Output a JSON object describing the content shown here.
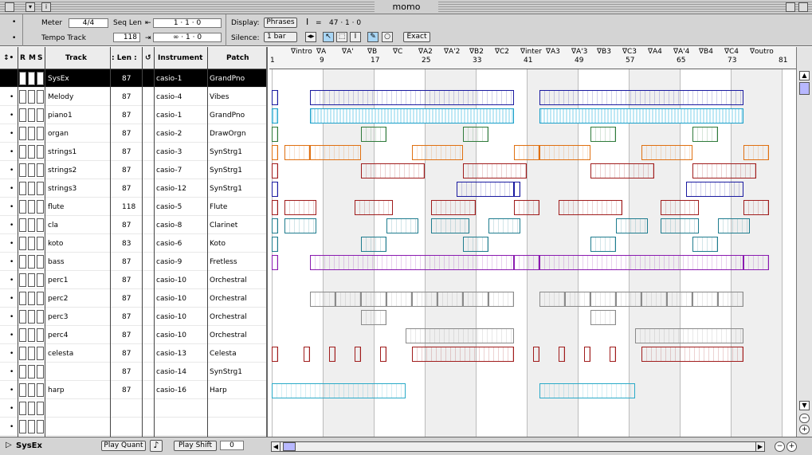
{
  "window": {
    "title": "momo"
  },
  "toolbar": {
    "meter_label": "Meter",
    "meter_value": "4/4",
    "seqlen_label": "Seq Len",
    "seqlen_value": "118",
    "tempo_label": "Tempo Track",
    "position_start": "1 · 1 · 0",
    "position_end": "∞ · 1 · 0",
    "display_label": "Display:",
    "display_value": "Phrases",
    "silence_label": "Silence:",
    "silence_value": "1 bar",
    "cursor_pos": "47 · 1 · 0",
    "exact_label": "Exact"
  },
  "tracklist": {
    "headers": {
      "r": "R",
      "m": "M",
      "s": "S",
      "track": "Track",
      "len": ": Len :",
      "instrument": "Instrument",
      "patch": "Patch"
    },
    "rows": [
      {
        "name": "SysEx",
        "len": "87",
        "instrument": "casio-1",
        "patch": "GrandPno"
      },
      {
        "name": "Melody",
        "len": "87",
        "instrument": "casio-4",
        "patch": "Vibes"
      },
      {
        "name": "piano1",
        "len": "87",
        "instrument": "casio-1",
        "patch": "GrandPno"
      },
      {
        "name": "organ",
        "len": "87",
        "instrument": "casio-2",
        "patch": "DrawOrgn"
      },
      {
        "name": "strings1",
        "len": "87",
        "instrument": "casio-3",
        "patch": "SynStrg1"
      },
      {
        "name": "strings2",
        "len": "87",
        "instrument": "casio-7",
        "patch": "SynStrg1"
      },
      {
        "name": "strings3",
        "len": "87",
        "instrument": "casio-12",
        "patch": "SynStrg1"
      },
      {
        "name": "flute",
        "len": "118",
        "instrument": "casio-5",
        "patch": "Flute"
      },
      {
        "name": "cla",
        "len": "87",
        "instrument": "casio-8",
        "patch": "Clarinet"
      },
      {
        "name": "koto",
        "len": "83",
        "instrument": "casio-6",
        "patch": "Koto"
      },
      {
        "name": "bass",
        "len": "87",
        "instrument": "casio-9",
        "patch": "Fretless"
      },
      {
        "name": "perc1",
        "len": "87",
        "instrument": "casio-10",
        "patch": "Orchestral"
      },
      {
        "name": "perc2",
        "len": "87",
        "instrument": "casio-10",
        "patch": "Orchestral"
      },
      {
        "name": "perc3",
        "len": "87",
        "instrument": "casio-10",
        "patch": "Orchestral"
      },
      {
        "name": "perc4",
        "len": "87",
        "instrument": "casio-10",
        "patch": "Orchestral"
      },
      {
        "name": "celesta",
        "len": "87",
        "instrument": "casio-13",
        "patch": "Celesta"
      },
      {
        "name": "",
        "len": "87",
        "instrument": "casio-14",
        "patch": "SynStrg1"
      },
      {
        "name": "harp",
        "len": "87",
        "instrument": "casio-16",
        "patch": "Harp"
      },
      {
        "name": "",
        "len": "",
        "instrument": "",
        "patch": ""
      },
      {
        "name": "",
        "len": "",
        "instrument": "",
        "patch": ""
      }
    ]
  },
  "ruler": {
    "markers": [
      {
        "label": "∇intro",
        "bar": 3
      },
      {
        "label": "∇A",
        "bar": 7
      },
      {
        "label": "∇A'",
        "bar": 11
      },
      {
        "label": "∇B",
        "bar": 15
      },
      {
        "label": "∇C",
        "bar": 19
      },
      {
        "label": "∇A2",
        "bar": 23
      },
      {
        "label": "∇A'2",
        "bar": 27
      },
      {
        "label": "∇B2",
        "bar": 31
      },
      {
        "label": "∇C2",
        "bar": 35
      },
      {
        "label": "∇inter",
        "bar": 39
      },
      {
        "label": "∇A3",
        "bar": 43
      },
      {
        "label": "∇A'3",
        "bar": 47
      },
      {
        "label": "∇B3",
        "bar": 51
      },
      {
        "label": "∇C3",
        "bar": 55
      },
      {
        "label": "∇A4",
        "bar": 59
      },
      {
        "label": "∇A'4",
        "bar": 63
      },
      {
        "label": "∇B4",
        "bar": 67
      },
      {
        "label": "∇C4",
        "bar": 71
      },
      {
        "label": "∇outro",
        "bar": 75
      }
    ],
    "bars": [
      "1",
      "9",
      "17",
      "25",
      "33",
      "41",
      "49",
      "57",
      "65",
      "73",
      "81"
    ]
  },
  "colors": {
    "blue": "#1a1aa0",
    "cyan": "#1a9fc8",
    "green": "#2e7a3a",
    "orange": "#e07010",
    "red": "#a01c1c",
    "teal": "#1e7c8e",
    "purple": "#8a1ab0",
    "gray": "#8a8a8a",
    "harp": "#2aaac8"
  },
  "phrases": [
    {
      "row": 1,
      "color": "blue",
      "from": 1,
      "to": 2
    },
    {
      "row": 1,
      "color": "blue",
      "from": 7,
      "to": 39
    },
    {
      "row": 1,
      "color": "blue",
      "from": 43,
      "to": 75
    },
    {
      "row": 2,
      "color": "cyan",
      "from": 1,
      "to": 2
    },
    {
      "row": 2,
      "color": "cyan",
      "from": 7,
      "to": 39
    },
    {
      "row": 2,
      "color": "cyan",
      "from": 43,
      "to": 75
    },
    {
      "row": 3,
      "color": "green",
      "from": 1,
      "to": 2
    },
    {
      "row": 3,
      "color": "green",
      "from": 15,
      "to": 19
    },
    {
      "row": 3,
      "color": "green",
      "from": 31,
      "to": 35
    },
    {
      "row": 3,
      "color": "green",
      "from": 51,
      "to": 55
    },
    {
      "row": 3,
      "color": "green",
      "from": 67,
      "to": 71
    },
    {
      "row": 4,
      "color": "orange",
      "from": 1,
      "to": 2
    },
    {
      "row": 4,
      "color": "orange",
      "from": 3,
      "to": 7
    },
    {
      "row": 4,
      "color": "orange",
      "from": 7,
      "to": 15
    },
    {
      "row": 4,
      "color": "orange",
      "from": 23,
      "to": 31
    },
    {
      "row": 4,
      "color": "orange",
      "from": 39,
      "to": 43
    },
    {
      "row": 4,
      "color": "orange",
      "from": 43,
      "to": 51
    },
    {
      "row": 4,
      "color": "orange",
      "from": 59,
      "to": 67
    },
    {
      "row": 4,
      "color": "orange",
      "from": 75,
      "to": 79
    },
    {
      "row": 5,
      "color": "red",
      "from": 1,
      "to": 2
    },
    {
      "row": 5,
      "color": "red",
      "from": 15,
      "to": 25
    },
    {
      "row": 5,
      "color": "red",
      "from": 31,
      "to": 41
    },
    {
      "row": 5,
      "color": "red",
      "from": 51,
      "to": 61
    },
    {
      "row": 5,
      "color": "red",
      "from": 67,
      "to": 77
    },
    {
      "row": 6,
      "color": "blue",
      "from": 1,
      "to": 2
    },
    {
      "row": 6,
      "color": "blue",
      "from": 30,
      "to": 39
    },
    {
      "row": 6,
      "color": "blue",
      "from": 39,
      "to": 40
    },
    {
      "row": 6,
      "color": "blue",
      "from": 66,
      "to": 75
    },
    {
      "row": 7,
      "color": "red",
      "from": 1,
      "to": 2
    },
    {
      "row": 7,
      "color": "red",
      "from": 3,
      "to": 8
    },
    {
      "row": 7,
      "color": "red",
      "from": 14,
      "to": 20
    },
    {
      "row": 7,
      "color": "red",
      "from": 26,
      "to": 33
    },
    {
      "row": 7,
      "color": "red",
      "from": 39,
      "to": 43
    },
    {
      "row": 7,
      "color": "red",
      "from": 46,
      "to": 56
    },
    {
      "row": 7,
      "color": "red",
      "from": 62,
      "to": 68
    },
    {
      "row": 7,
      "color": "red",
      "from": 75,
      "to": 79
    },
    {
      "row": 8,
      "color": "teal",
      "from": 1,
      "to": 2
    },
    {
      "row": 8,
      "color": "teal",
      "from": 3,
      "to": 8
    },
    {
      "row": 8,
      "color": "teal",
      "from": 19,
      "to": 24
    },
    {
      "row": 8,
      "color": "teal",
      "from": 26,
      "to": 32
    },
    {
      "row": 8,
      "color": "teal",
      "from": 35,
      "to": 40
    },
    {
      "row": 8,
      "color": "teal",
      "from": 55,
      "to": 60
    },
    {
      "row": 8,
      "color": "teal",
      "from": 62,
      "to": 68
    },
    {
      "row": 8,
      "color": "teal",
      "from": 71,
      "to": 76
    },
    {
      "row": 9,
      "color": "teal",
      "from": 1,
      "to": 2
    },
    {
      "row": 9,
      "color": "teal",
      "from": 15,
      "to": 19
    },
    {
      "row": 9,
      "color": "teal",
      "from": 31,
      "to": 35
    },
    {
      "row": 9,
      "color": "teal",
      "from": 51,
      "to": 55
    },
    {
      "row": 9,
      "color": "teal",
      "from": 67,
      "to": 71
    },
    {
      "row": 10,
      "color": "purple",
      "from": 1,
      "to": 2
    },
    {
      "row": 10,
      "color": "purple",
      "from": 7,
      "to": 39
    },
    {
      "row": 10,
      "color": "purple",
      "from": 39,
      "to": 43
    },
    {
      "row": 10,
      "color": "purple",
      "from": 43,
      "to": 75
    },
    {
      "row": 10,
      "color": "purple",
      "from": 75,
      "to": 79
    },
    {
      "row": 12,
      "color": "gray",
      "from": 7,
      "to": 11
    },
    {
      "row": 12,
      "color": "gray",
      "from": 11,
      "to": 15
    },
    {
      "row": 12,
      "color": "gray",
      "from": 15,
      "to": 19
    },
    {
      "row": 12,
      "color": "gray",
      "from": 19,
      "to": 23
    },
    {
      "row": 12,
      "color": "gray",
      "from": 23,
      "to": 27
    },
    {
      "row": 12,
      "color": "gray",
      "from": 27,
      "to": 31
    },
    {
      "row": 12,
      "color": "gray",
      "from": 31,
      "to": 35
    },
    {
      "row": 12,
      "color": "gray",
      "from": 35,
      "to": 39
    },
    {
      "row": 12,
      "color": "gray",
      "from": 43,
      "to": 47
    },
    {
      "row": 12,
      "color": "gray",
      "from": 47,
      "to": 51
    },
    {
      "row": 12,
      "color": "gray",
      "from": 51,
      "to": 55
    },
    {
      "row": 12,
      "color": "gray",
      "from": 55,
      "to": 59
    },
    {
      "row": 12,
      "color": "gray",
      "from": 59,
      "to": 63
    },
    {
      "row": 12,
      "color": "gray",
      "from": 63,
      "to": 67
    },
    {
      "row": 12,
      "color": "gray",
      "from": 67,
      "to": 71
    },
    {
      "row": 12,
      "color": "gray",
      "from": 71,
      "to": 75
    },
    {
      "row": 13,
      "color": "gray",
      "from": 15,
      "to": 19
    },
    {
      "row": 13,
      "color": "gray",
      "from": 51,
      "to": 55
    },
    {
      "row": 14,
      "color": "gray",
      "from": 22,
      "to": 39
    },
    {
      "row": 14,
      "color": "gray",
      "from": 58,
      "to": 75
    },
    {
      "row": 15,
      "color": "red",
      "from": 1,
      "to": 2
    },
    {
      "row": 15,
      "color": "red",
      "from": 6,
      "to": 7
    },
    {
      "row": 15,
      "color": "red",
      "from": 10,
      "to": 11
    },
    {
      "row": 15,
      "color": "red",
      "from": 14,
      "to": 15
    },
    {
      "row": 15,
      "color": "red",
      "from": 18,
      "to": 19
    },
    {
      "row": 15,
      "color": "red",
      "from": 23,
      "to": 39
    },
    {
      "row": 15,
      "color": "red",
      "from": 42,
      "to": 43
    },
    {
      "row": 15,
      "color": "red",
      "from": 46,
      "to": 47
    },
    {
      "row": 15,
      "color": "red",
      "from": 50,
      "to": 51
    },
    {
      "row": 15,
      "color": "red",
      "from": 54,
      "to": 55
    },
    {
      "row": 15,
      "color": "red",
      "from": 59,
      "to": 75
    },
    {
      "row": 17,
      "color": "harp",
      "from": 1,
      "to": 22
    },
    {
      "row": 17,
      "color": "harp",
      "from": 43,
      "to": 58
    }
  ],
  "bottom": {
    "track_name": "SysEx",
    "play_quant_label": "Play Quant",
    "play_shift_label": "Play Shift",
    "play_shift_value": "0"
  }
}
